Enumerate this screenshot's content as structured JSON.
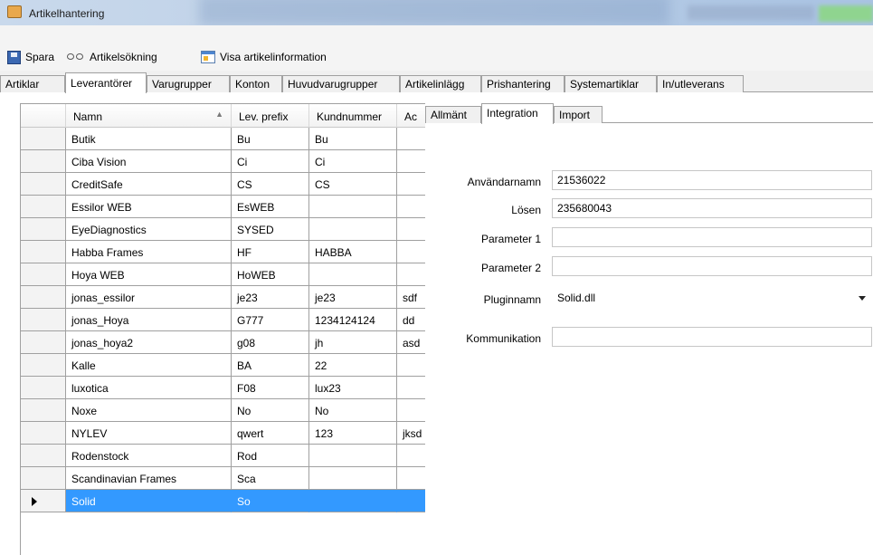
{
  "window": {
    "title": "Artikelhantering"
  },
  "toolbar": {
    "save_label": "Spara",
    "search_label": "Artikelsökning",
    "info_label": "Visa artikelinformation"
  },
  "main_tabs": [
    {
      "label": "Artiklar",
      "active": false
    },
    {
      "label": "Leverantörer",
      "active": true
    },
    {
      "label": "Varugrupper",
      "active": false
    },
    {
      "label": "Konton",
      "active": false
    },
    {
      "label": "Huvudvarugrupper",
      "active": false
    },
    {
      "label": "Artikelinlägg",
      "active": false
    },
    {
      "label": "Prishantering",
      "active": false
    },
    {
      "label": "Systemartiklar",
      "active": false
    },
    {
      "label": "In/utleverans",
      "active": false
    }
  ],
  "grid": {
    "columns": [
      "Namn",
      "Lev. prefix",
      "Kundnummer",
      "Ac"
    ],
    "sort_column": "Namn",
    "rows": [
      [
        "Butik",
        "Bu",
        "Bu",
        ""
      ],
      [
        "Ciba Vision",
        "Ci",
        "Ci",
        ""
      ],
      [
        "CreditSafe",
        "CS",
        "CS",
        ""
      ],
      [
        "Essilor WEB",
        "EsWEB",
        "",
        ""
      ],
      [
        "EyeDiagnostics",
        "SYSED",
        "",
        ""
      ],
      [
        "Habba Frames",
        "HF",
        "HABBA",
        ""
      ],
      [
        "Hoya WEB",
        "HoWEB",
        "",
        ""
      ],
      [
        "jonas_essilor",
        "je23",
        "je23",
        "sdf"
      ],
      [
        "jonas_Hoya",
        "G777",
        "1234124124",
        "dd"
      ],
      [
        "jonas_hoya2",
        "g08",
        "jh",
        "asd"
      ],
      [
        "Kalle",
        "BA",
        "22",
        ""
      ],
      [
        "luxotica",
        "F08",
        "lux23",
        ""
      ],
      [
        "Noxe",
        "No",
        "No",
        ""
      ],
      [
        "NYLEV",
        "qwert",
        "123",
        "jksd"
      ],
      [
        "Rodenstock",
        "Rod",
        "",
        ""
      ],
      [
        "Scandinavian Frames",
        "Sca",
        "",
        ""
      ],
      [
        "Solid",
        "So",
        "",
        ""
      ]
    ],
    "selected_index": 16
  },
  "panel": {
    "tabs": [
      {
        "label": "Allmänt",
        "active": false
      },
      {
        "label": "Integration",
        "active": true
      },
      {
        "label": "Import",
        "active": false
      }
    ],
    "fields": {
      "username": {
        "label": "Användarnamn",
        "value": "21536022"
      },
      "password": {
        "label": "Lösen",
        "value": "235680043"
      },
      "param1": {
        "label": "Parameter 1",
        "value": ""
      },
      "param2": {
        "label": "Parameter 2",
        "value": ""
      },
      "plugin": {
        "label": "Pluginnamn",
        "value": "Solid.dll"
      },
      "comm": {
        "label": "Kommunikation",
        "value": ""
      }
    }
  },
  "colors": {
    "selection": "#3399ff",
    "titlebar": "#b9cde5",
    "grid_border": "#a0a0a0"
  }
}
